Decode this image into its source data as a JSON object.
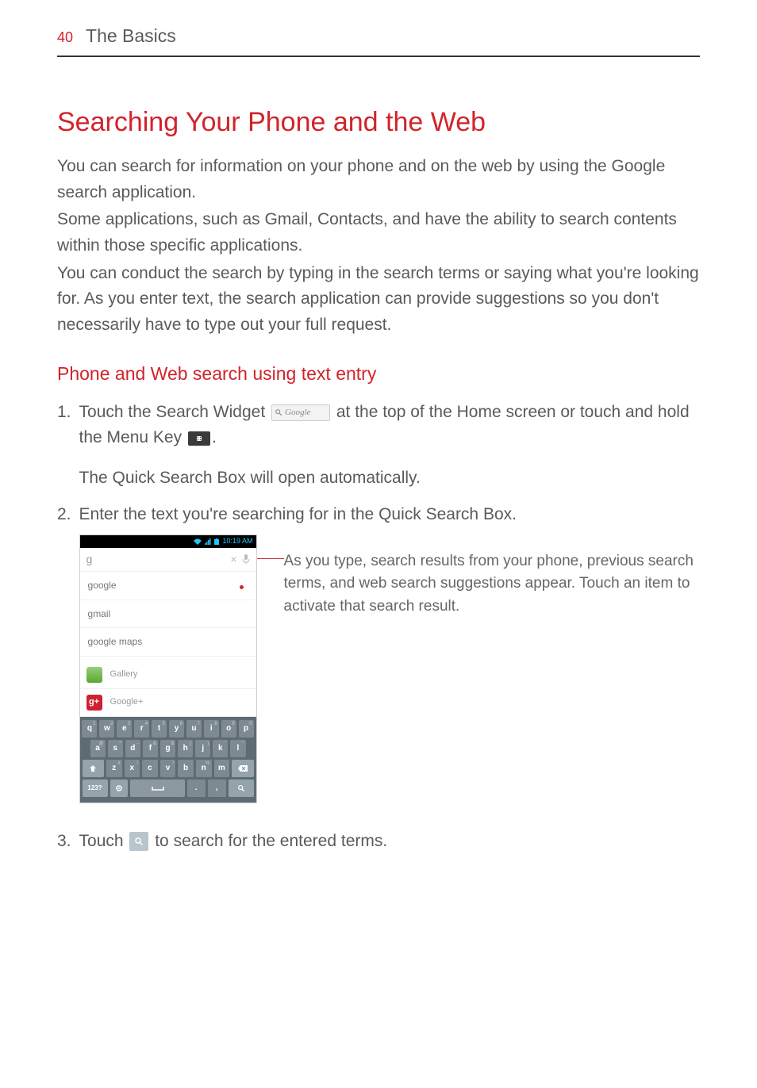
{
  "header": {
    "page_number": "40",
    "section": "The Basics"
  },
  "title": "Searching Your Phone and the Web",
  "intro": [
    "You can search for information on your phone and on the web by using the Google search application.",
    "Some applications, such as Gmail, Contacts, and have the ability to search contents within those specific applications.",
    "You can conduct the search by typing in the search terms or saying what you're looking for. As you enter text, the search application can provide suggestions so you don't necessarily have to type out your full request."
  ],
  "subheading": "Phone and Web search using text entry",
  "steps": {
    "one": {
      "num": "1.",
      "pre": "Touch the ",
      "widget_bold": "Search Widget",
      "widget_label": "Google",
      "mid": " at the top of the Home screen or touch and hold the ",
      "menu_bold": "Menu Key",
      "post": ".",
      "sub": "The Quick Search Box will open automatically."
    },
    "two": {
      "num": "2.",
      "text": "Enter the text you're searching for in the Quick Search Box."
    },
    "three": {
      "num": "3.",
      "pre": "Touch ",
      "post": " to search for the entered terms."
    }
  },
  "screenshot": {
    "status_time": "10:19 AM",
    "query": "g",
    "suggestions": [
      "google",
      "gmail",
      "google maps"
    ],
    "apps": [
      "Gallery",
      "Google+"
    ],
    "keyboard": {
      "row1": [
        {
          "k": "q",
          "s": "1"
        },
        {
          "k": "w",
          "s": "2"
        },
        {
          "k": "e",
          "s": "3"
        },
        {
          "k": "r",
          "s": "4"
        },
        {
          "k": "t",
          "s": "5"
        },
        {
          "k": "y",
          "s": "6"
        },
        {
          "k": "u",
          "s": "7"
        },
        {
          "k": "i",
          "s": "8"
        },
        {
          "k": "o",
          "s": "9"
        },
        {
          "k": "p",
          "s": "0"
        }
      ],
      "row2": [
        {
          "k": "a",
          "s": "@"
        },
        {
          "k": "s",
          "s": "*"
        },
        {
          "k": "d",
          "s": "-"
        },
        {
          "k": "f",
          "s": "&"
        },
        {
          "k": "g",
          "s": "$"
        },
        {
          "k": "h",
          "s": "("
        },
        {
          "k": "j",
          "s": ")"
        },
        {
          "k": "k",
          "s": "'"
        },
        {
          "k": "l",
          "s": "\""
        }
      ],
      "row3": [
        {
          "k": "z",
          "s": "#"
        },
        {
          "k": "x",
          "s": "!"
        },
        {
          "k": "c",
          "s": ";"
        },
        {
          "k": "v",
          "s": "/"
        },
        {
          "k": "b",
          "s": ":"
        },
        {
          "k": "n",
          "s": "%"
        },
        {
          "k": "m",
          "s": "."
        }
      ],
      "row4_left": "123?",
      "row4_period": ".",
      "row4_comma": ","
    }
  },
  "caption": "As you type, search results from your phone, previous search terms, and web search suggestions appear. Touch an item to activate that search result."
}
